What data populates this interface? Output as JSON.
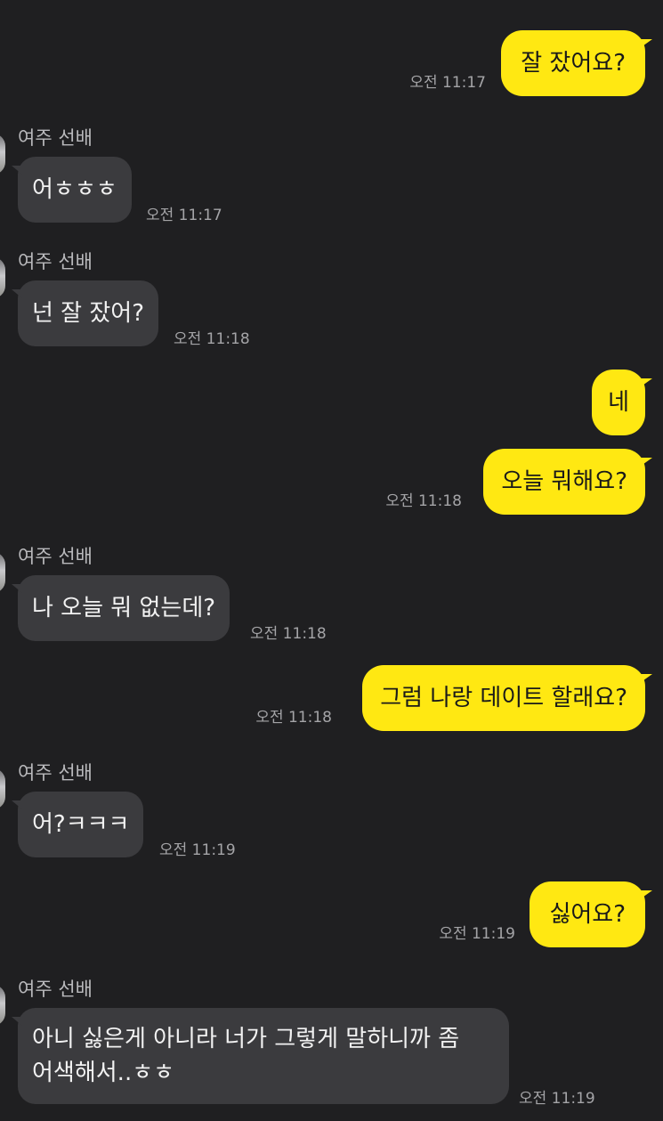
{
  "messages": [
    {
      "side": "out",
      "sender": "",
      "text": "잘 잤어요?",
      "time": "오전 11:17"
    },
    {
      "side": "in",
      "sender": "여주 선배",
      "text": "어ㅎㅎㅎ",
      "time": "오전 11:17"
    },
    {
      "side": "in",
      "sender": "여주 선배",
      "text": "넌 잘 잤어?",
      "time": "오전 11:18"
    },
    {
      "side": "out",
      "sender": "",
      "text": "네",
      "time": ""
    },
    {
      "side": "out",
      "sender": "",
      "text": "오늘 뭐해요?",
      "time": "오전 11:18"
    },
    {
      "side": "in",
      "sender": "여주 선배",
      "text": "나 오늘 뭐 없는데?",
      "time": "오전 11:18"
    },
    {
      "side": "out",
      "sender": "",
      "text": "그럼 나랑 데이트 할래요?",
      "time": "오전 11:18"
    },
    {
      "side": "in",
      "sender": "여주 선배",
      "text": "어?ㅋㅋㅋ",
      "time": "오전 11:19"
    },
    {
      "side": "out",
      "sender": "",
      "text": "싫어요?",
      "time": "오전 11:19"
    },
    {
      "side": "in",
      "sender": "여주 선배",
      "text_lines": [
        "아니 싫은게 아니라 너가 그렇게 말하니까 좀",
        "어색해서..ㅎㅎ"
      ],
      "time": "오전 11:19"
    }
  ],
  "colors": {
    "background": "#1f1f21",
    "incoming_bubble": "#3b3b3e",
    "outgoing_bubble": "#ffe812",
    "incoming_text": "#f2f2f2",
    "outgoing_text": "#191919",
    "meta_text": "#a4a4a7"
  },
  "icons": {
    "avatar": "profile-avatar"
  }
}
